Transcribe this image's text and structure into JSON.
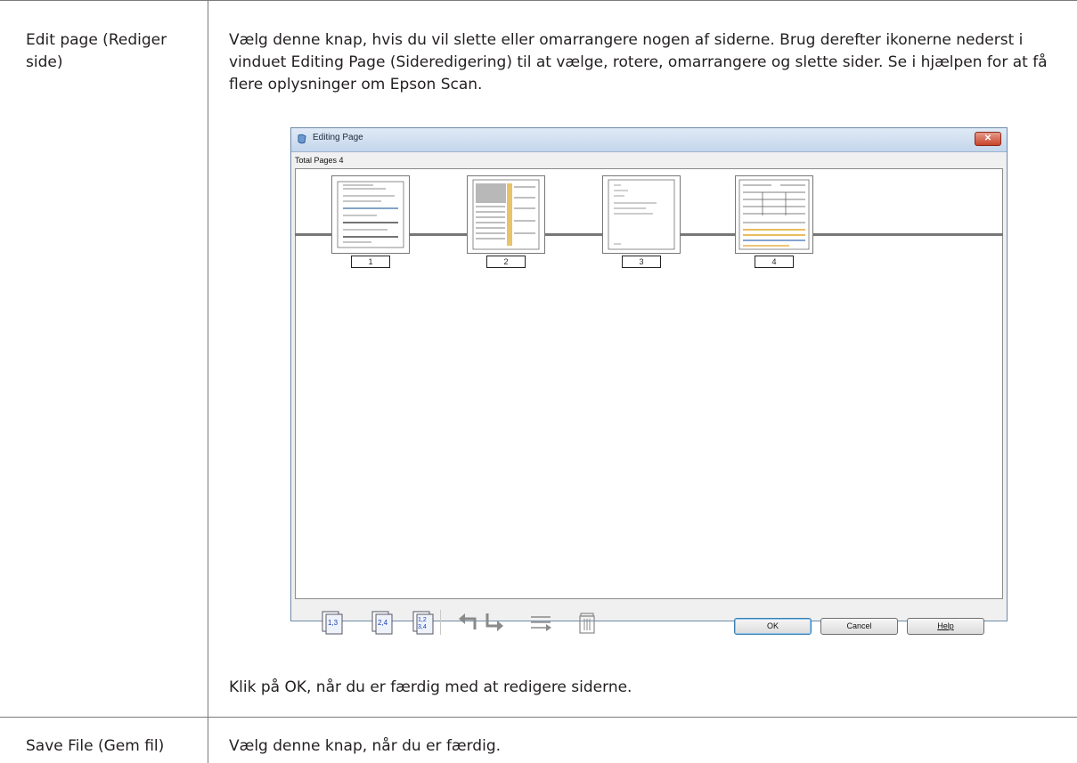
{
  "rows": [
    {
      "label": "Edit page (Rediger side)",
      "description": "Vælg denne knap, hvis du vil slette eller omarrangere nogen af siderne. Brug derefter ikonerne nederst i vinduet Editing Page (Sideredigering) til at vælge, rotere, omarrangere og slette sider. Se i hjælpen for at få flere oplysninger om Epson Scan.",
      "note": "Klik på OK, når du er færdig med at redigere siderne."
    },
    {
      "label": "Save File (Gem fil)",
      "description": "Vælg denne knap, når du er færdig."
    }
  ],
  "dialog": {
    "title": "Editing Page",
    "close_glyph": "✕",
    "total_pages": "Total Pages 4",
    "pages": [
      "1",
      "2",
      "3",
      "4"
    ],
    "toolbar_icons": [
      "select-odd-pages-icon",
      "select-even-pages-icon",
      "select-all-pages-icon",
      "rotate-left-icon",
      "rotate-right-icon",
      "reorder-pages-icon",
      "delete-page-icon"
    ],
    "buttons": {
      "ok": "OK",
      "cancel": "Cancel",
      "help": "Help"
    }
  }
}
